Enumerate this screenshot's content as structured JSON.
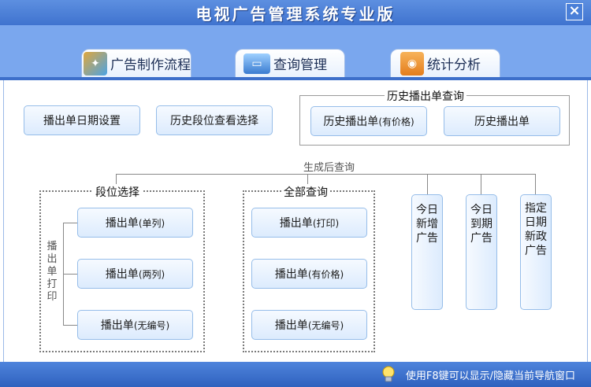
{
  "window": {
    "title": "电视广告管理系统专业版",
    "close_label": "×"
  },
  "tabs": [
    {
      "label": "广告制作流程",
      "icon": "app-icon"
    },
    {
      "label": "查询管理",
      "icon": "monitor-icon"
    },
    {
      "label": "统计分析",
      "icon": "rss-icon"
    }
  ],
  "buttons": {
    "date_setting": "播出单日期设置",
    "history_segment": "历史段位查看选择",
    "history_with_price": "历史播出单",
    "history_with_price_suffix": "(有价格)",
    "history_list": "历史播出单"
  },
  "groups": {
    "history_query": "历史播出单查询",
    "after_generate": "生成后查询",
    "segment_select": "段位选择",
    "all_query": "全部查询",
    "print_label": "播出单打印"
  },
  "segment_buttons": [
    {
      "label": "播出单",
      "suffix": "(单列)"
    },
    {
      "label": "播出单",
      "suffix": "(两列)"
    },
    {
      "label": "播出单",
      "suffix": "(无编号)"
    }
  ],
  "all_buttons": [
    {
      "label": "播出单",
      "suffix": "(打印)"
    },
    {
      "label": "播出单",
      "suffix": "(有价格)"
    },
    {
      "label": "播出单",
      "suffix": "(无编号)"
    }
  ],
  "vertical_buttons": [
    "今日新增广告",
    "今日到期广告",
    "指定日期新政广告"
  ],
  "status": {
    "hint": "使用F8键可以显示/隐藏当前导航窗口"
  }
}
